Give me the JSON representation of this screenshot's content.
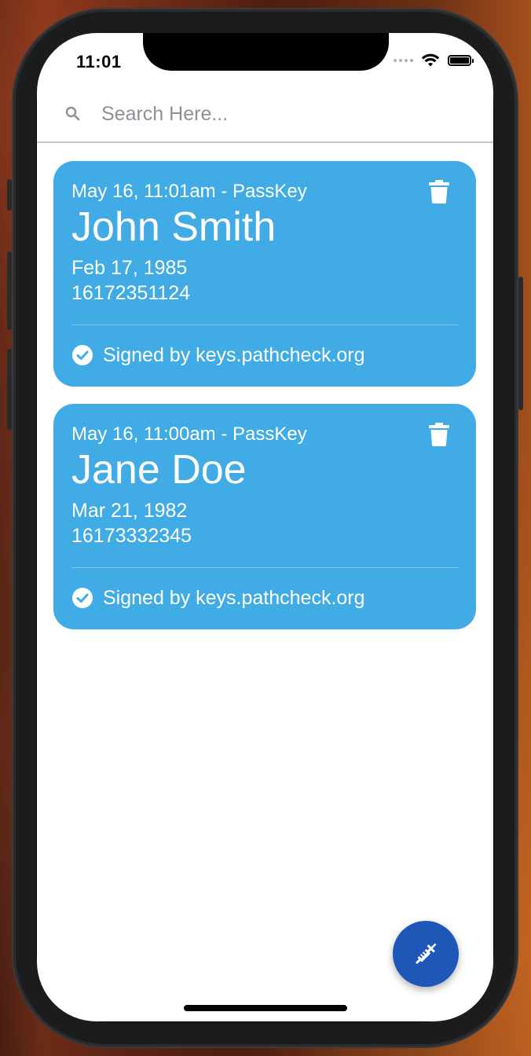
{
  "status_bar": {
    "time": "11:01"
  },
  "search": {
    "placeholder": "Search Here..."
  },
  "cards": [
    {
      "meta": "May 16, 11:01am - PassKey",
      "name": "John Smith",
      "dob": "Feb 17, 1985",
      "phone": "16172351124",
      "signed_by": "Signed by keys.pathcheck.org"
    },
    {
      "meta": "May 16, 11:00am - PassKey",
      "name": "Jane Doe",
      "dob": "Mar 21, 1982",
      "phone": "16173332345",
      "signed_by": "Signed by keys.pathcheck.org"
    }
  ],
  "icons": {
    "search": "search-icon",
    "trash": "trash-icon",
    "check": "check-circle-icon",
    "fab": "syringe-icon"
  },
  "colors": {
    "card": "#41abe6",
    "fab": "#1f57b8",
    "search_text": "#8a9299"
  }
}
